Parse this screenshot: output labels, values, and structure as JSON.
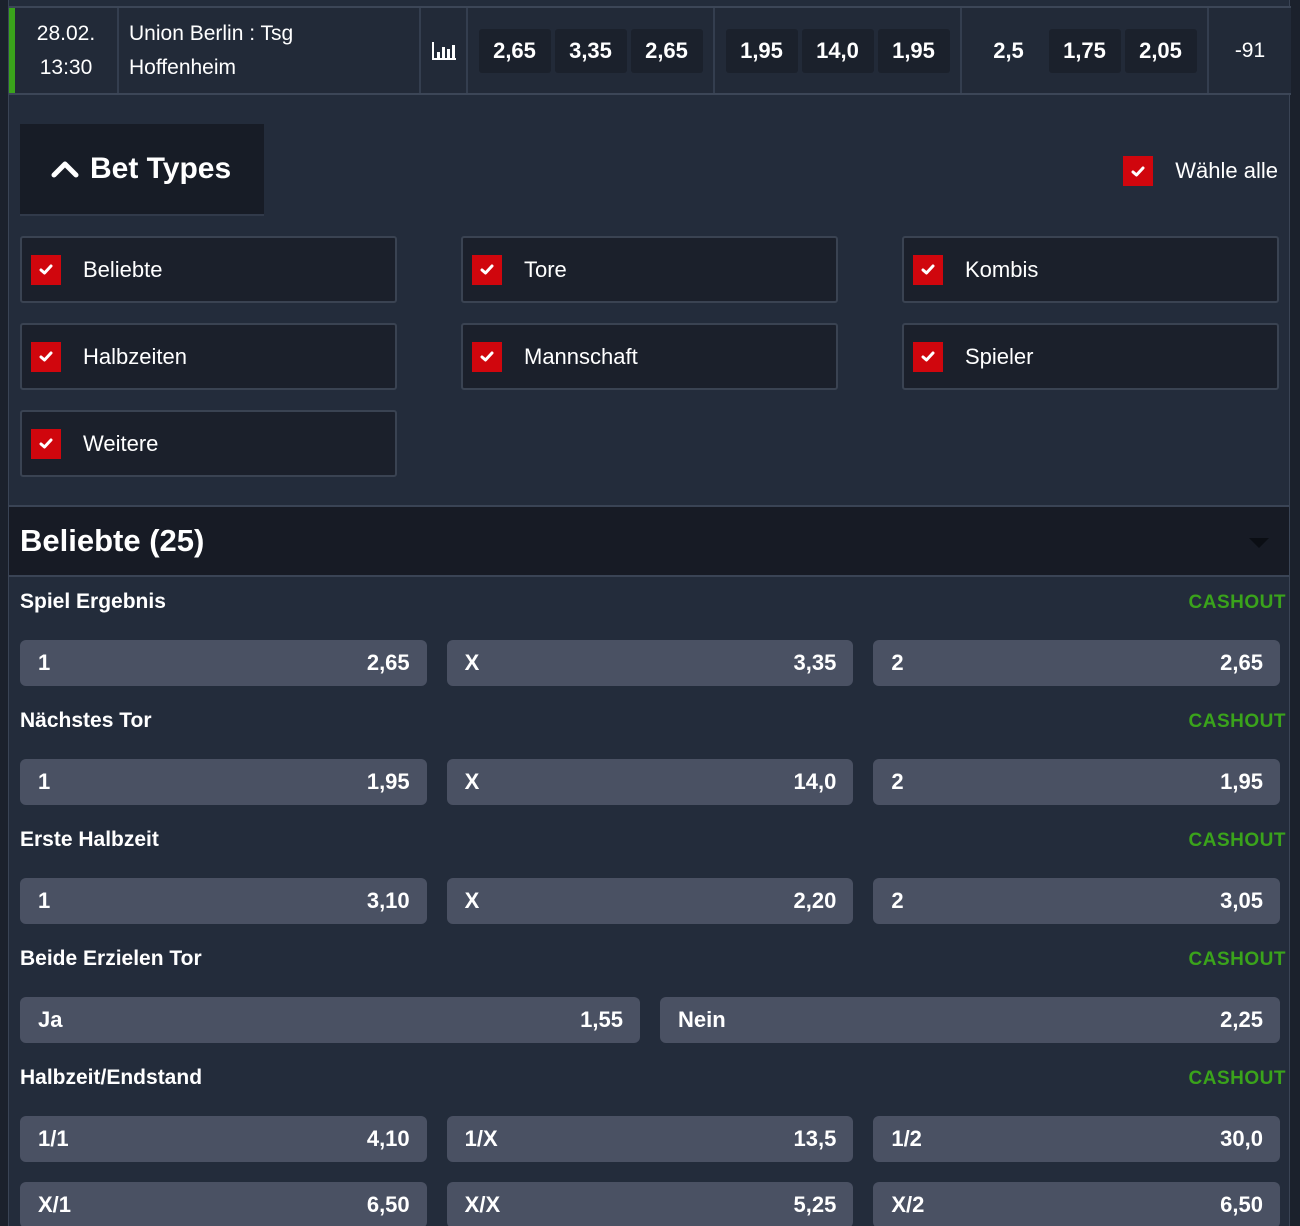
{
  "match": {
    "date": "28.02.",
    "time": "13:30",
    "team_line1": "Union Berlin : Tsg",
    "team_line2": "Hoffenheim",
    "stats_icon": "bar-chart-icon",
    "odds_groups": [
      [
        "2,65",
        "3,35",
        "2,65"
      ],
      [
        "1,95",
        "14,0",
        "1,95"
      ],
      [
        "2,5",
        "1,75",
        "2,05"
      ]
    ],
    "more_markets": "-91",
    "live_color": "#3aa31b"
  },
  "bet_types": {
    "toggle_label": "Bet Types",
    "toggle_icon": "chevron-up-icon",
    "select_all_label": "Wähle alle",
    "select_all_checked": true,
    "items": [
      {
        "label": "Beliebte",
        "checked": true
      },
      {
        "label": "Tore",
        "checked": true
      },
      {
        "label": "Kombis",
        "checked": true
      },
      {
        "label": "Halbzeiten",
        "checked": true
      },
      {
        "label": "Mannschaft",
        "checked": true
      },
      {
        "label": "Spieler",
        "checked": true
      },
      {
        "label": "Weitere",
        "checked": true
      }
    ]
  },
  "section": {
    "title": "Beliebte (25)",
    "collapse_icon": "caret-down-icon"
  },
  "markets": [
    {
      "title": "Spiel Ergebnis",
      "cashout": "CASHOUT",
      "rows": [
        [
          {
            "label": "1",
            "odd": "2,65"
          },
          {
            "label": "X",
            "odd": "3,35"
          },
          {
            "label": "2",
            "odd": "2,65"
          }
        ]
      ]
    },
    {
      "title": "Nächstes Tor",
      "cashout": "CASHOUT",
      "rows": [
        [
          {
            "label": "1",
            "odd": "1,95"
          },
          {
            "label": "X",
            "odd": "14,0"
          },
          {
            "label": "2",
            "odd": "1,95"
          }
        ]
      ]
    },
    {
      "title": "Erste Halbzeit",
      "cashout": "CASHOUT",
      "rows": [
        [
          {
            "label": "1",
            "odd": "3,10"
          },
          {
            "label": "X",
            "odd": "2,20"
          },
          {
            "label": "2",
            "odd": "3,05"
          }
        ]
      ]
    },
    {
      "title": "Beide Erzielen Tor",
      "cashout": "CASHOUT",
      "rows": [
        [
          {
            "label": "Ja",
            "odd": "1,55"
          },
          {
            "label": "Nein",
            "odd": "2,25"
          }
        ]
      ]
    },
    {
      "title": "Halbzeit/Endstand",
      "cashout": "CASHOUT",
      "rows": [
        [
          {
            "label": "1/1",
            "odd": "4,10"
          },
          {
            "label": "1/X",
            "odd": "13,5"
          },
          {
            "label": "1/2",
            "odd": "30,0"
          }
        ],
        [
          {
            "label": "X/1",
            "odd": "6,50"
          },
          {
            "label": "X/X",
            "odd": "5,25"
          },
          {
            "label": "X/2",
            "odd": "6,50"
          }
        ]
      ]
    }
  ],
  "colors": {
    "accent_green": "#3aa31b",
    "checkbox_red": "#d0060d",
    "background": "#232c3b",
    "selection_bg": "#4a5163"
  }
}
